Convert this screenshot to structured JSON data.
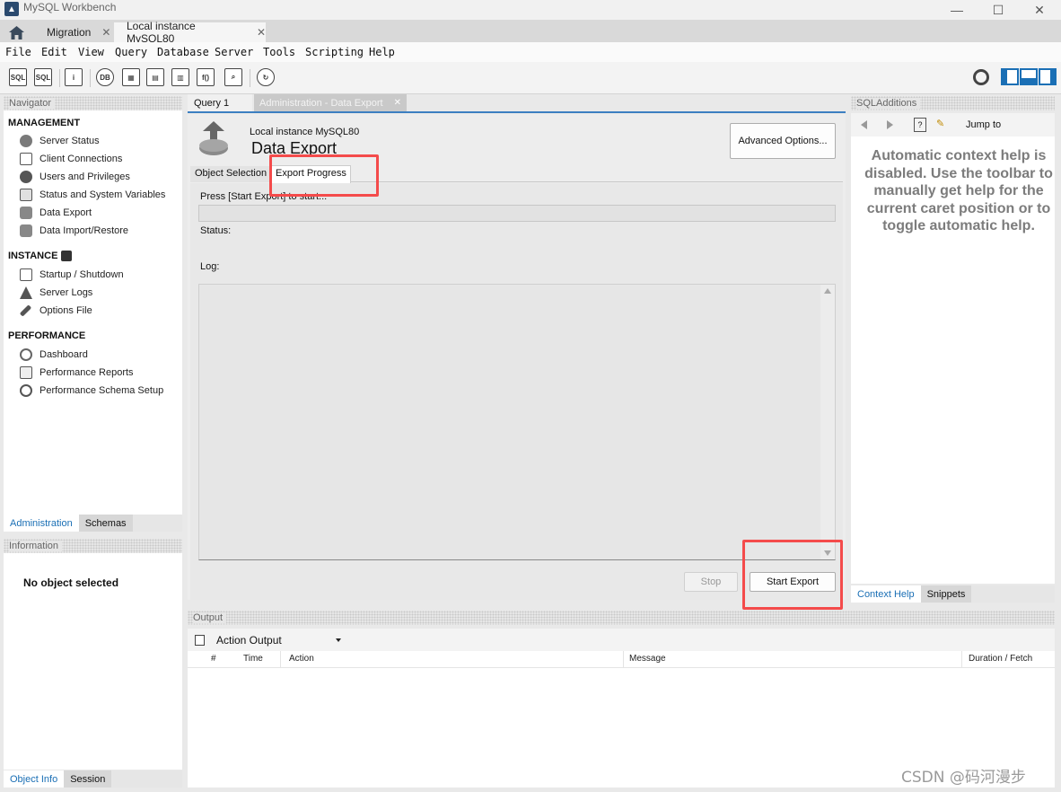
{
  "window": {
    "title": "MySQL Workbench",
    "minimize": "—",
    "maximize": "☐",
    "close": "✕"
  },
  "tabs": [
    {
      "label": "Migration",
      "close": "✕"
    },
    {
      "label": "Local instance MySQL80",
      "close": "✕"
    }
  ],
  "menu": [
    "File",
    "Edit",
    "View",
    "Query",
    "Database",
    "Server",
    "Tools",
    "Scripting",
    "Help"
  ],
  "toolbar_icons": [
    "new-sql-tab-icon",
    "open-sql-script-icon",
    "inspector-icon",
    "create-schema-icon",
    "create-table-icon",
    "create-view-icon",
    "create-procedure-icon",
    "create-function-icon",
    "search-table-data-icon",
    "reconnect-icon"
  ],
  "navigator": {
    "title": "Navigator",
    "management": {
      "heading": "MANAGEMENT",
      "items": [
        "Server Status",
        "Client Connections",
        "Users and Privileges",
        "Status and System Variables",
        "Data Export",
        "Data Import/Restore"
      ]
    },
    "instance": {
      "heading": "INSTANCE",
      "items": [
        "Startup / Shutdown",
        "Server Logs",
        "Options File"
      ]
    },
    "performance": {
      "heading": "PERFORMANCE",
      "items": [
        "Dashboard",
        "Performance Reports",
        "Performance Schema Setup"
      ]
    },
    "tabs": [
      "Administration",
      "Schemas"
    ]
  },
  "information": {
    "title": "Information",
    "empty": "No object selected",
    "tabs": [
      "Object Info",
      "Session"
    ]
  },
  "editor_tabs": [
    {
      "label": "Query 1"
    },
    {
      "label": "Administration - Data Export",
      "close": "✕"
    }
  ],
  "export": {
    "instance": "Local instance MySQL80",
    "title": "Data Export",
    "advanced_button": "Advanced Options...",
    "subtabs": [
      "Object Selection",
      "Export Progress"
    ],
    "press_text": "Press [Start Export] to start...",
    "status_label": "Status:",
    "log_label": "Log:",
    "stop_button": "Stop",
    "start_button": "Start Export"
  },
  "sql_additions": {
    "title": "SQLAdditions",
    "jump_to": "Jump to",
    "help_text": "Automatic context help is disabled. Use the toolbar to manually get help for the current caret position or to toggle automatic help.",
    "tabs": [
      "Context Help",
      "Snippets"
    ]
  },
  "output": {
    "title": "Output",
    "selector": "Action Output",
    "columns": [
      "#",
      "Time",
      "Action",
      "Message",
      "Duration / Fetch"
    ]
  },
  "watermark": "CSDN @码河漫步",
  "colors": {
    "accent": "#1a6fb5",
    "highlight": "#f44b4b",
    "tab_active_bar": "#3c7fc1"
  }
}
